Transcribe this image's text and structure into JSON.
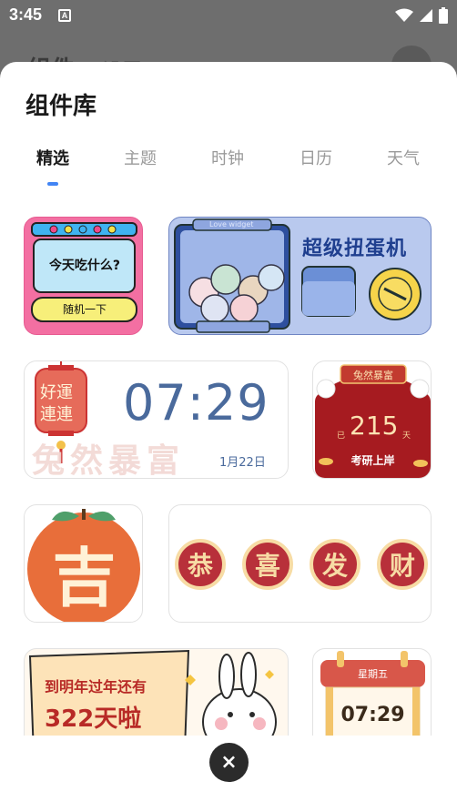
{
  "status_bar": {
    "time": "3:45",
    "notification_glyph": "A"
  },
  "background_page": {
    "title_fragment": "组件",
    "second_fragment": "设置"
  },
  "sheet": {
    "title": "组件库",
    "tabs": [
      {
        "label": "精选",
        "active": true
      },
      {
        "label": "主题",
        "active": false
      },
      {
        "label": "时钟",
        "active": false
      },
      {
        "label": "日历",
        "active": false
      },
      {
        "label": "天气",
        "active": false
      }
    ]
  },
  "widgets": {
    "food": {
      "headline": "今天吃什么?",
      "button": "随机一下"
    },
    "gacha": {
      "title": "超级扭蛋机",
      "tag": "Love widget"
    },
    "clock_luck": {
      "charm_top": "好運",
      "charm_bottom": "連連",
      "time": "07:29",
      "date": "1月22日",
      "watermark": "兔然暴富"
    },
    "countdown": {
      "banner": "兔然暴富",
      "prefix": "已",
      "number": "215",
      "suffix": "天",
      "caption": "考研上岸"
    },
    "orange": {
      "glyph": "吉"
    },
    "blessings": {
      "chars": [
        "恭",
        "喜",
        "发",
        "财"
      ]
    },
    "newyear": {
      "line1": "到明年过年还有",
      "line2": "322天啦"
    },
    "calendar_clock": {
      "weekday": "星期五",
      "time": "07:29"
    }
  },
  "close_label": "×",
  "colors": {
    "accent": "#4285f4",
    "pink": "#f36fa2",
    "red": "#b8242a",
    "orange": "#e86e3a"
  }
}
